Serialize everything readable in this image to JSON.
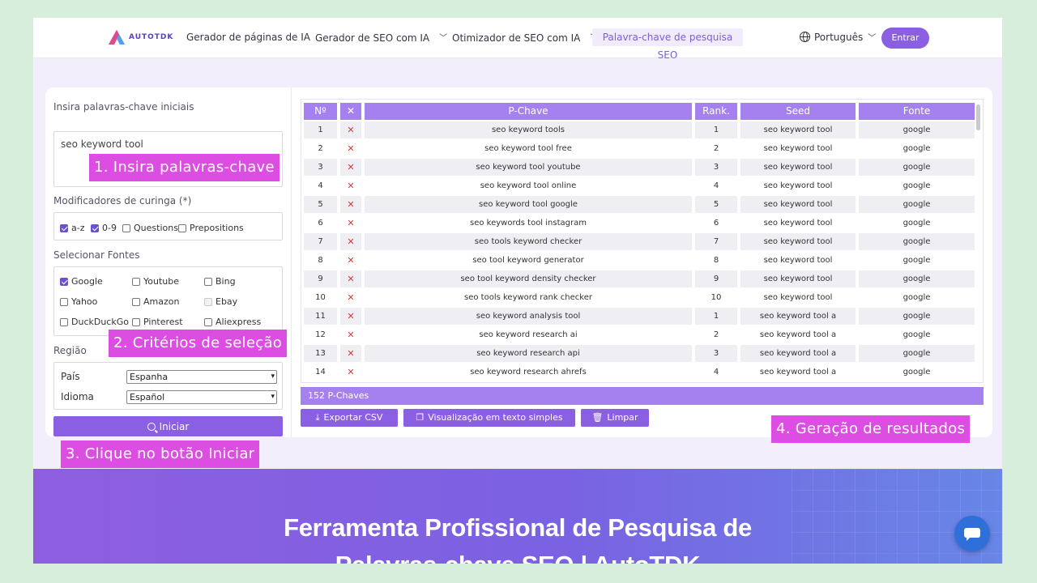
{
  "nav": {
    "logo_text": "AUTOTDK",
    "links": [
      {
        "label": "Gerador de páginas de IA",
        "dropdown": false
      },
      {
        "label": "Gerador de SEO com IA",
        "dropdown": true
      },
      {
        "label": "Otimizador de SEO com IA",
        "dropdown": true
      }
    ],
    "active": "Palavra-chave de pesquisa SEO",
    "language": "Português",
    "login": "Entrar"
  },
  "form": {
    "keywords_label": "Insira palavras-chave iniciais",
    "keywords_value": "seo keyword tool",
    "wildcard_label": "Modificadores de curinga (*)",
    "wildcards": [
      {
        "label": "a-z",
        "checked": true
      },
      {
        "label": "0-9",
        "checked": true
      },
      {
        "label": "Questions",
        "checked": false
      },
      {
        "label": "Prepositions",
        "checked": false
      }
    ],
    "sources_label": "Selecionar Fontes",
    "sources": [
      {
        "label": "Google",
        "checked": true,
        "disabled": false
      },
      {
        "label": "Youtube",
        "checked": false,
        "disabled": false
      },
      {
        "label": "Bing",
        "checked": false,
        "disabled": false
      },
      {
        "label": "Yahoo",
        "checked": false,
        "disabled": false
      },
      {
        "label": "Amazon",
        "checked": false,
        "disabled": false
      },
      {
        "label": "Ebay",
        "checked": false,
        "disabled": true
      },
      {
        "label": "DuckDuckGo",
        "checked": false,
        "disabled": false
      },
      {
        "label": "Pinterest",
        "checked": false,
        "disabled": false
      },
      {
        "label": "Aliexpress",
        "checked": false,
        "disabled": false
      }
    ],
    "region_label": "Região",
    "country_label": "País",
    "country_value": "Espanha",
    "language_label": "Idioma",
    "language_value": "Español",
    "start_button": "Iniciar"
  },
  "table": {
    "headers": [
      "Nº",
      "✕",
      "P-Chave",
      "Rank.",
      "Seed",
      "Fonte"
    ],
    "rows": [
      {
        "n": "1",
        "keyword": "seo keyword tools",
        "rank": "1",
        "seed": "seo keyword tool",
        "source": "google"
      },
      {
        "n": "2",
        "keyword": "seo keyword tool free",
        "rank": "2",
        "seed": "seo keyword tool",
        "source": "google"
      },
      {
        "n": "3",
        "keyword": "seo keyword tool youtube",
        "rank": "3",
        "seed": "seo keyword tool",
        "source": "google"
      },
      {
        "n": "4",
        "keyword": "seo keyword tool online",
        "rank": "4",
        "seed": "seo keyword tool",
        "source": "google"
      },
      {
        "n": "5",
        "keyword": "seo keyword tool google",
        "rank": "5",
        "seed": "seo keyword tool",
        "source": "google"
      },
      {
        "n": "6",
        "keyword": "seo keywords tool instagram",
        "rank": "6",
        "seed": "seo keyword tool",
        "source": "google"
      },
      {
        "n": "7",
        "keyword": "seo tools keyword checker",
        "rank": "7",
        "seed": "seo keyword tool",
        "source": "google"
      },
      {
        "n": "8",
        "keyword": "seo tool keyword generator",
        "rank": "8",
        "seed": "seo keyword tool",
        "source": "google"
      },
      {
        "n": "9",
        "keyword": "seo tool keyword density checker",
        "rank": "9",
        "seed": "seo keyword tool",
        "source": "google"
      },
      {
        "n": "10",
        "keyword": "seo tools keyword rank checker",
        "rank": "10",
        "seed": "seo keyword tool",
        "source": "google"
      },
      {
        "n": "11",
        "keyword": "seo keyword analysis tool",
        "rank": "1",
        "seed": "seo keyword tool a",
        "source": "google"
      },
      {
        "n": "12",
        "keyword": "seo keyword research ai",
        "rank": "2",
        "seed": "seo keyword tool a",
        "source": "google"
      },
      {
        "n": "13",
        "keyword": "seo keyword research api",
        "rank": "3",
        "seed": "seo keyword tool a",
        "source": "google"
      },
      {
        "n": "14",
        "keyword": "seo keyword research ahrefs",
        "rank": "4",
        "seed": "seo keyword tool a",
        "source": "google"
      }
    ],
    "delete_symbol": "✕",
    "count_label": "152 P-Chaves"
  },
  "actions": {
    "export_csv": "Exportar CSV",
    "plain_text": "Visualização em texto simples",
    "clear": "Limpar"
  },
  "callouts": {
    "step1": "1. Insira palavras-chave",
    "step2": "2. Critérios de seleção",
    "step3": "3. Clique no botão Iniciar",
    "step4": "4. Geração de resultados"
  },
  "hero": {
    "title_line1": "Ferramenta Profissional de Pesquisa de",
    "title_line2": "Palavras-chave SEO | AutoTDK"
  },
  "colors": {
    "accent": "#8a5fe2",
    "table_header": "#a581ef",
    "callout": "#dc4ee2",
    "background": "#d8eedc"
  }
}
